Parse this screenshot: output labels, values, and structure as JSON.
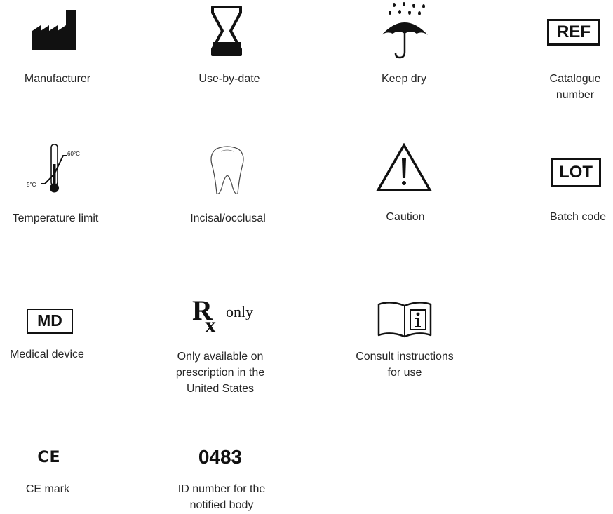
{
  "symbols": [
    {
      "icon": "factory-icon",
      "label": "Manufacturer"
    },
    {
      "icon": "hourglass-icon",
      "label": "Use-by-date"
    },
    {
      "icon": "umbrella-rain-icon",
      "label": "Keep dry"
    },
    {
      "icon": "ref-box-icon",
      "label": "Catalogue\nnumber",
      "icon_text": "REF"
    },
    {
      "icon": "thermometer-icon",
      "label": "Temperature limit",
      "icon_text_high": "60°C",
      "icon_text_low": "5°C"
    },
    {
      "icon": "tooth-icon",
      "label": "Incisal/occlusal"
    },
    {
      "icon": "warning-triangle-icon",
      "label": "Caution"
    },
    {
      "icon": "lot-box-icon",
      "label": "Batch code",
      "icon_text": "LOT"
    },
    {
      "icon": "md-box-icon",
      "label": "Medical device",
      "icon_text": "MD"
    },
    {
      "icon": "rx-only-icon",
      "label": "Only available on\nprescription in the\nUnited States",
      "icon_text": "only"
    },
    {
      "icon": "instructions-book-icon",
      "label": "Consult instructions\nfor use"
    },
    {
      "icon": "ce-mark-icon",
      "label": "CE mark",
      "icon_text": "CE"
    },
    {
      "icon": "notified-body-number",
      "label": "ID number for the\nnotified body",
      "icon_text": "0483"
    }
  ]
}
